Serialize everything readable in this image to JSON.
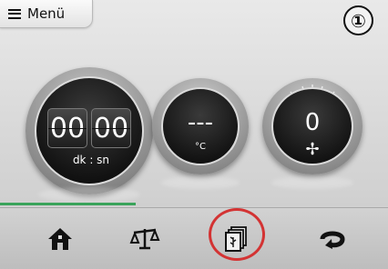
{
  "header": {
    "menu_label": "Menü",
    "step_number": "①"
  },
  "timer": {
    "minutes": "00",
    "seconds": "00",
    "units": "dk : sn"
  },
  "temperature": {
    "value": "---",
    "unit": "°C"
  },
  "fan": {
    "value": "0"
  },
  "progress": {
    "fraction": 0.35,
    "color": "#3aa35b"
  },
  "bottom_nav": {
    "items": [
      {
        "icon": "home-icon"
      },
      {
        "icon": "scale-icon"
      },
      {
        "icon": "program-book-icon",
        "highlighted": true
      },
      {
        "icon": "fan-rotate-icon"
      }
    ],
    "highlight_color": "#d33333"
  }
}
